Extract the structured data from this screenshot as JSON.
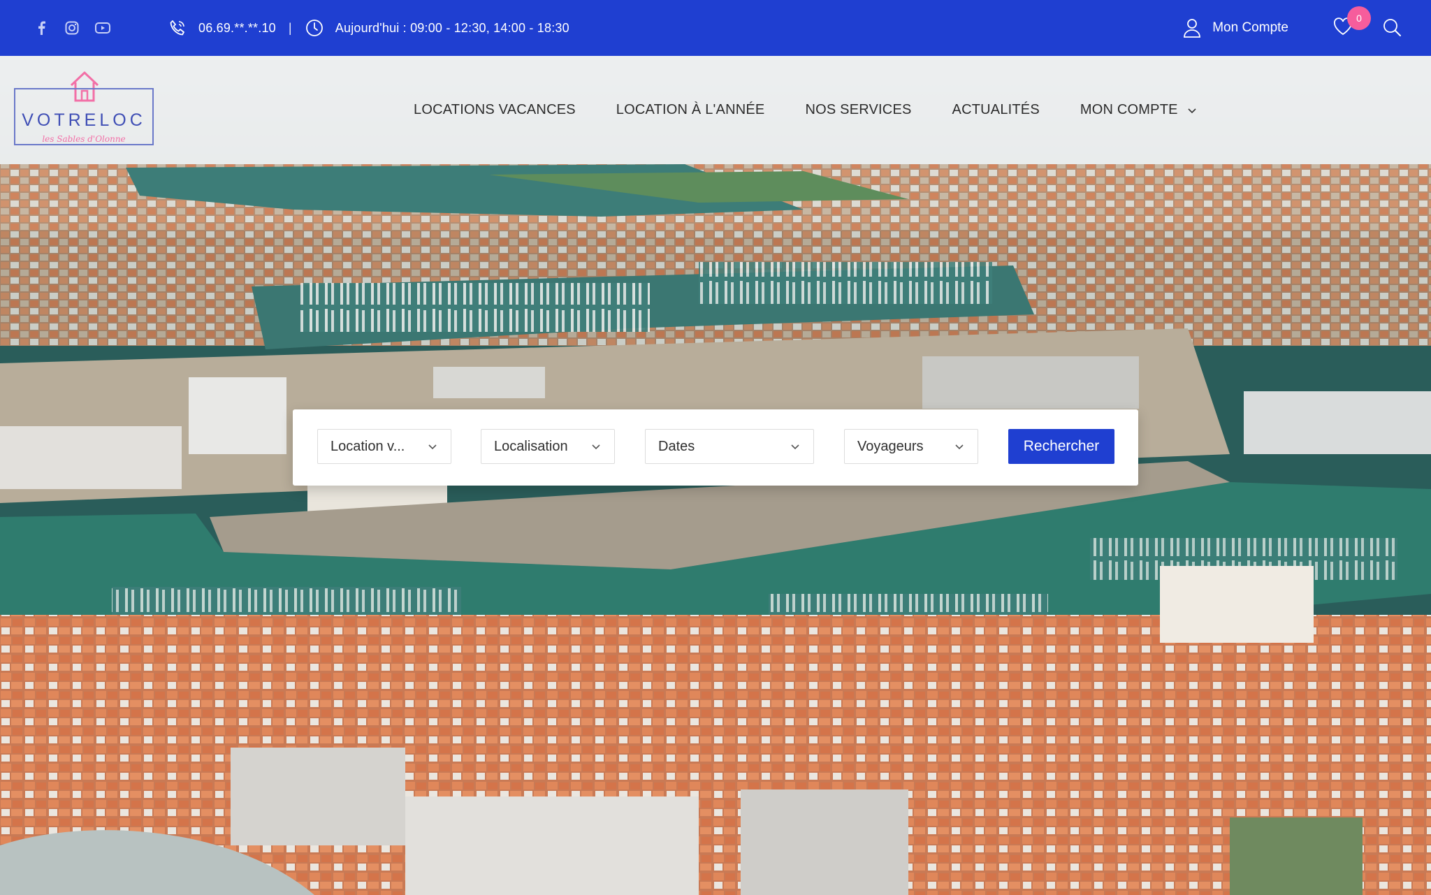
{
  "topbar": {
    "phone": "06.69.**.**.10",
    "separator": "|",
    "hours": "Aujourd'hui : 09:00 - 12:30, 14:00 - 18:30",
    "account_label": "Mon Compte",
    "wishlist_count": "0",
    "social_icons": [
      "facebook-icon",
      "instagram-icon",
      "youtube-icon"
    ],
    "background_color": "#1f3fd1",
    "badge_color": "#f65d9c"
  },
  "logo": {
    "wordmark": "VOTRELOC",
    "tagline": "les Sables d'Olonne"
  },
  "nav": {
    "items": [
      {
        "label": "LOCATIONS VACANCES"
      },
      {
        "label": "LOCATION À L'ANNÉE"
      },
      {
        "label": "NOS SERVICES"
      },
      {
        "label": "ACTUALITÉS"
      },
      {
        "label": "MON COMPTE"
      }
    ]
  },
  "search": {
    "type_value": "Location v...",
    "location_value": "Localisation",
    "dates_value": "Dates",
    "guests_value": "Voyageurs",
    "submit_label": "Rechercher",
    "button_color": "#1f3fd1"
  }
}
